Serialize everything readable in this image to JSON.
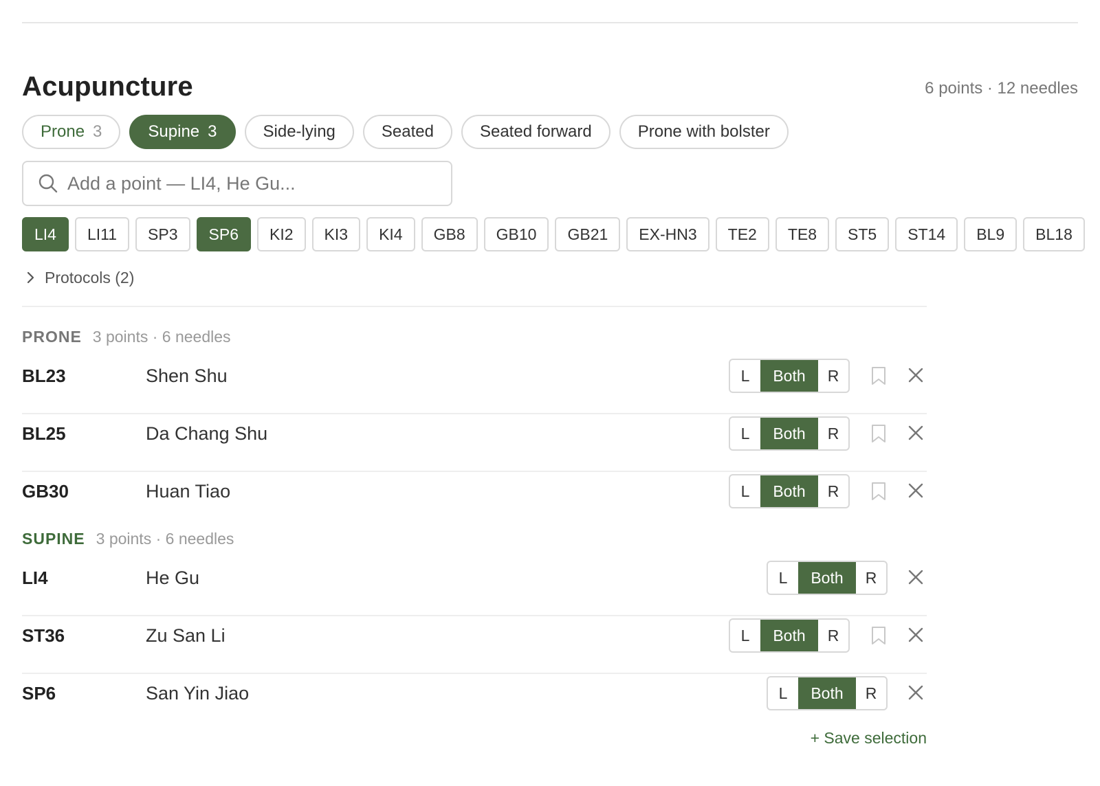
{
  "title": "Acupuncture",
  "summary": "6 points · 12 needles",
  "positions": [
    {
      "label": "Prone",
      "count": "3"
    },
    {
      "label": "Supine",
      "count": "3"
    },
    {
      "label": "Side-lying",
      "count": ""
    },
    {
      "label": "Seated",
      "count": ""
    },
    {
      "label": "Seated forward",
      "count": ""
    },
    {
      "label": "Prone with bolster",
      "count": ""
    }
  ],
  "search": {
    "placeholder": "Add a point — LI4, He Gu..."
  },
  "quick_points": [
    "LI4",
    "LI11",
    "SP3",
    "SP6",
    "KI2",
    "KI3",
    "KI4",
    "GB8",
    "GB10",
    "GB21",
    "EX-HN3",
    "TE2",
    "TE8",
    "ST5",
    "ST14",
    "BL9",
    "BL18"
  ],
  "protocols_label": "Protocols (2)",
  "groups": {
    "prone": {
      "name": "PRONE",
      "meta": "3 points · 6 needles",
      "points": [
        {
          "code": "BL23",
          "name": "Shen Shu"
        },
        {
          "code": "BL25",
          "name": "Da Chang Shu"
        },
        {
          "code": "GB30",
          "name": "Huan Tiao"
        }
      ]
    },
    "supine": {
      "name": "SUPINE",
      "meta": "3 points · 6 needles",
      "points": [
        {
          "code": "LI4",
          "name": "He Gu"
        },
        {
          "code": "ST36",
          "name": "Zu San Li"
        },
        {
          "code": "SP6",
          "name": "San Yin Jiao"
        }
      ]
    }
  },
  "side_labels": {
    "left": "L",
    "both": "Both",
    "right": "R"
  },
  "save_label": "+ Save selection",
  "colors": {
    "accent": "#4b6b42",
    "accent_text": "#3e6b3a",
    "border": "#d8d8d8",
    "muted": "#999999"
  },
  "icons": {
    "search": "search-icon",
    "protocols": "chevron-right-icon",
    "bookmark": "bookmark-icon",
    "remove": "close-icon"
  }
}
